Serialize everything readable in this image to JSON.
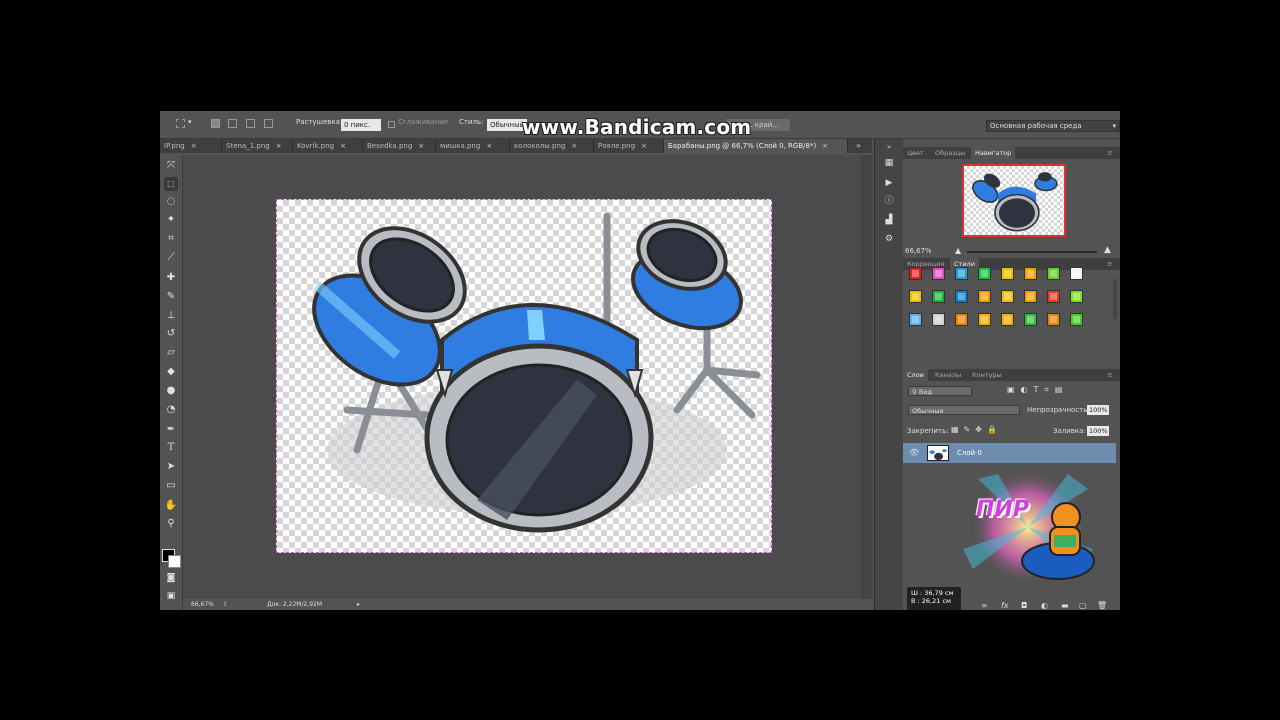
{
  "options_bar": {
    "feather_label": "Растушевка:",
    "feather_value": "0 пикс.",
    "antialias_label": "Сглаживание",
    "style_label": "Стиль:",
    "style_value": "Обычный",
    "refine_label": "Уточн. край...",
    "workspace": "Основная рабочая среда"
  },
  "watermark": "www.Bandicam.com",
  "tabs": [
    {
      "label": "IP.png",
      "active": false
    },
    {
      "label": "Stena_1.png",
      "active": false
    },
    {
      "label": "Kovrik.png",
      "active": false
    },
    {
      "label": "Besedka.png",
      "active": false
    },
    {
      "label": "мишка.png",
      "active": false
    },
    {
      "label": "колоколы.png",
      "active": false
    },
    {
      "label": "Рояле.png",
      "active": false
    },
    {
      "label": "Барабаны.png @ 66,7% (Слой 0, RGB/8*)",
      "active": true
    }
  ],
  "tab_close": "×",
  "status": {
    "zoom": "66,67%",
    "doc": "Док: 2,22M/2,92M"
  },
  "navigator_panel": {
    "tabs": [
      "Цвет",
      "Образцы",
      "Навигатор"
    ],
    "active_tab": "Навигатор",
    "zoom": "66,67%"
  },
  "styles_panel": {
    "tabs": [
      "Коррекция",
      "Стили"
    ],
    "active_tab": "Стили",
    "swatch_colors": [
      [
        "#e02020",
        "#e050c0",
        "#20a0d0",
        "#20c040",
        "#f0c000",
        "#f0a000",
        "#60d020",
        "#f4f4f4"
      ],
      [
        "#f0c000",
        "#20b040",
        "#1080d0",
        "#f0a000",
        "#f0c010",
        "#f0a000",
        "#e04020",
        "#80e020"
      ],
      [
        "#60b0f0",
        "#d0d0d0",
        "#f08000",
        "#f0b000",
        "#f0b000",
        "#30c040",
        "#f08000",
        "#40d020"
      ]
    ]
  },
  "layers_panel": {
    "tabs": [
      "Слои",
      "Каналы",
      "Контуры"
    ],
    "active_tab": "Слои",
    "filter_label": "Вид",
    "blend_mode": "Обычные",
    "opacity_label": "Непрозрачность:",
    "opacity_value": "100%",
    "lock_label": "Закрепить:",
    "fill_label": "Заливка:",
    "fill_value": "100%",
    "layers": [
      {
        "name": "Слой 0",
        "visible": true,
        "selected": true
      }
    ],
    "sticker_text": "ПИР"
  },
  "info_popup": {
    "width": "Ш :  36,79 см",
    "height": "В :  26,21 см"
  },
  "colors": {
    "app_bg": "#535353",
    "selection": "#d14fd1",
    "drum_blue": "#2f7de0",
    "drum_dark": "#2f3340"
  }
}
